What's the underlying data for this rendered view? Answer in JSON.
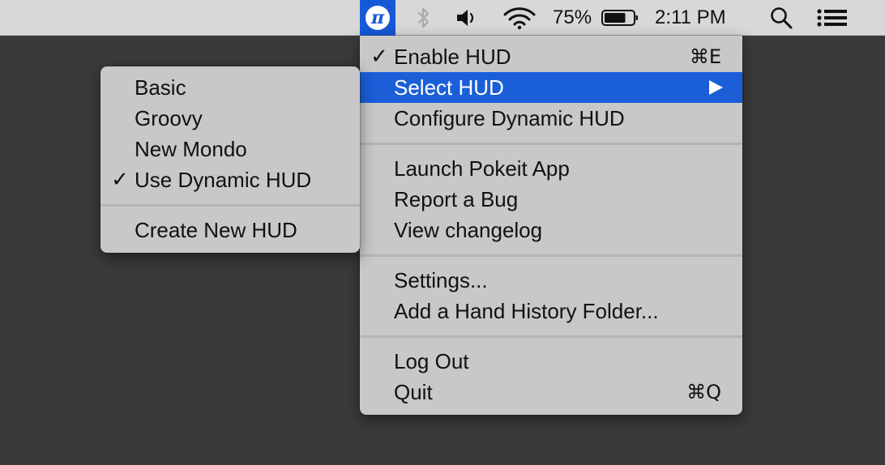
{
  "menubar": {
    "app_icon": {
      "symbol": "π",
      "name": "pokeit-app-icon",
      "bg_color": "#1559d6"
    },
    "battery_percent": "75%",
    "battery_level": 0.75,
    "clock": "2:11 PM",
    "background_color": "#d8d8d8"
  },
  "main_menu": {
    "items": [
      {
        "label": "Enable HUD",
        "checked": true,
        "shortcut": "⌘E"
      },
      {
        "label": "Select HUD",
        "highlighted": true,
        "submenu": true
      },
      {
        "label": "Configure Dynamic HUD"
      },
      {
        "label": "Launch Pokeit App"
      },
      {
        "label": "Report a Bug"
      },
      {
        "label": "View changelog"
      },
      {
        "label": "Settings..."
      },
      {
        "label": "Add a Hand History Folder..."
      },
      {
        "label": "Log Out"
      },
      {
        "label": "Quit",
        "shortcut": "⌘Q"
      }
    ],
    "highlight_color": "#1a5fd8"
  },
  "sub_menu": {
    "items": [
      {
        "label": "Basic"
      },
      {
        "label": "Groovy"
      },
      {
        "label": "New Mondo"
      },
      {
        "label": "Use Dynamic HUD",
        "checked": true
      },
      {
        "label": "Create New HUD"
      }
    ]
  },
  "check_symbol": "✓"
}
